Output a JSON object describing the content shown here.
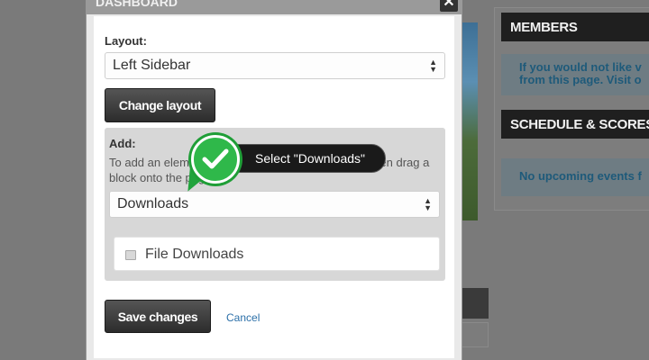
{
  "modal": {
    "title": "DASHBOARD",
    "close_label": "✕",
    "layout_label": "Layout:",
    "layout_value": "Left Sidebar",
    "change_layout_label": "Change layout",
    "add_label": "Add:",
    "add_description": "To add an element to this page, select a category, then drag a block onto the page.",
    "category_value": "Downloads",
    "elements": [
      {
        "label": "File Downloads",
        "icon": "document-icon"
      }
    ],
    "save_label": "Save changes",
    "cancel_label": "Cancel"
  },
  "callout": {
    "text": "Select \"Downloads\"",
    "icon": "checkmark-icon",
    "color": "#2fb84a"
  },
  "widgets": [
    {
      "title": "MEMBERS",
      "body_lines": [
        "If you would not like v",
        "from this page. Visit o"
      ]
    },
    {
      "title": "SCHEDULE & SCORES",
      "body_lines": [
        "No upcoming events f"
      ]
    }
  ],
  "colors": {
    "link": "#2b6fa8",
    "accent_green": "#2fb84a",
    "widget_header": "#1f1f1f"
  }
}
